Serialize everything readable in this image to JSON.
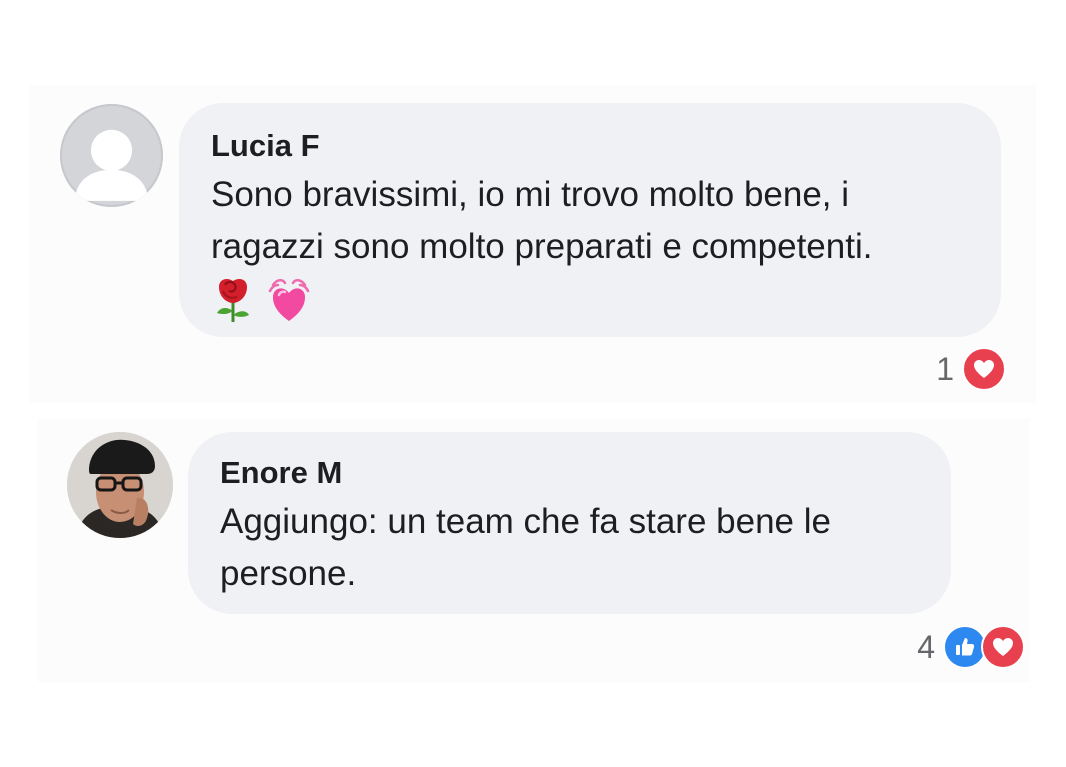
{
  "comments": [
    {
      "author": "Lucia F",
      "text": "Sono bravissimi, io mi trovo molto bene, i ragazzi sono molto preparati e competenti.",
      "emojis": [
        "rose-emoji",
        "beating-heart-emoji"
      ],
      "avatar_icon": "default-profile-icon",
      "reaction_count": "1",
      "reactions": [
        "love"
      ]
    },
    {
      "author": "Enore M",
      "text": "Aggiungo: un team che fa stare bene le persone.",
      "avatar_icon": "profile-photo",
      "reaction_count": "4",
      "reactions": [
        "like",
        "love"
      ]
    }
  ],
  "colors": {
    "bubble": "#f0f1f4",
    "text": "#1c1e21",
    "count": "#65676b",
    "love": "#e8404f",
    "like": "#2d88f0"
  }
}
